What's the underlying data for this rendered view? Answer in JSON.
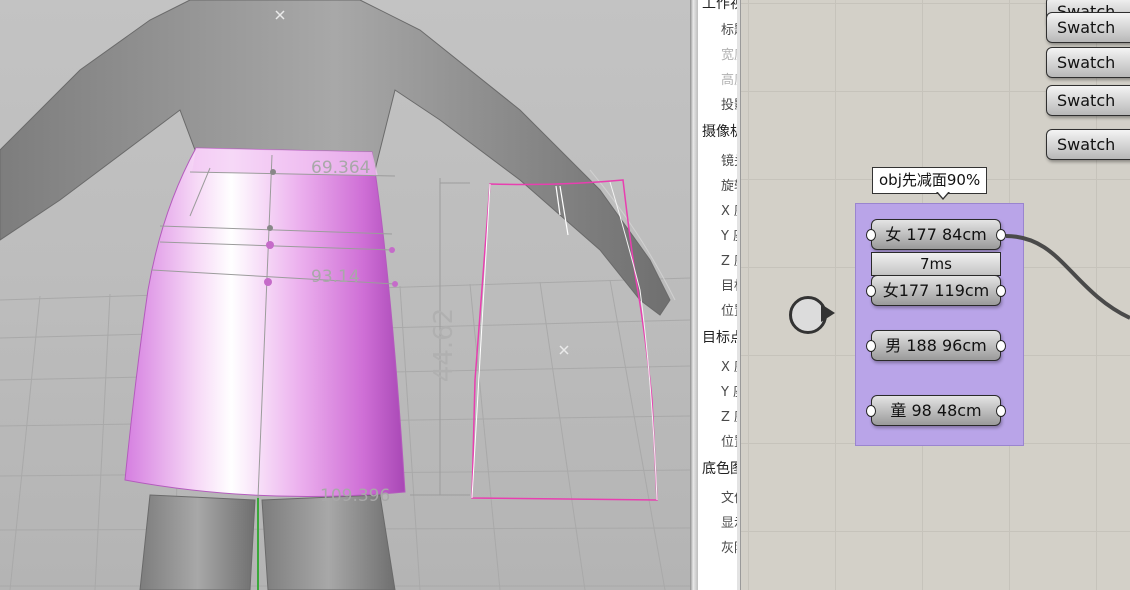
{
  "viewport": {
    "dimensions": {
      "waist": "69.364",
      "hip": "93.14",
      "length": "44.62",
      "hem": "109.396"
    },
    "colors": {
      "skirt": "#e79ce9",
      "pattern_outline": "#e83fb0",
      "body": "#8f8f8f",
      "background": "#c0c0c0"
    }
  },
  "properties_panel": {
    "rows": [
      {
        "label": "工作视",
        "type": "category"
      },
      {
        "label": "标题",
        "type": "item"
      },
      {
        "label": "宽度",
        "type": "item",
        "disabled": true
      },
      {
        "label": "高度",
        "type": "item",
        "disabled": true
      },
      {
        "label": "投影",
        "type": "item"
      },
      {
        "label": "摄像机",
        "type": "category"
      },
      {
        "label": "镜头",
        "type": "item"
      },
      {
        "label": "旋转",
        "type": "item"
      },
      {
        "label": "X 座",
        "type": "item"
      },
      {
        "label": "Y 座",
        "type": "item"
      },
      {
        "label": "Z 座",
        "type": "item"
      },
      {
        "label": "目标",
        "type": "item"
      },
      {
        "label": "位置",
        "type": "item"
      },
      {
        "label": "目标点",
        "type": "category"
      },
      {
        "label": "X 座",
        "type": "item"
      },
      {
        "label": "Y 座",
        "type": "item"
      },
      {
        "label": "Z 座",
        "type": "item"
      },
      {
        "label": "位置",
        "type": "item"
      },
      {
        "label": "底色图",
        "type": "category"
      },
      {
        "label": "文件",
        "type": "item"
      },
      {
        "label": "显示",
        "type": "item"
      },
      {
        "label": "灰阶",
        "type": "item"
      }
    ]
  },
  "canvas": {
    "swatches": [
      "Swatch",
      "Swatch",
      "Swatch",
      "Swatch"
    ],
    "group": {
      "callout": "obj先减面90%",
      "timer": "7ms",
      "nodes": [
        {
          "label": "女 177 84cm"
        },
        {
          "label": "女177 119cm"
        },
        {
          "label": "男 188 96cm"
        },
        {
          "label": "童 98 48cm"
        }
      ],
      "color": "#b9a4e8"
    }
  }
}
